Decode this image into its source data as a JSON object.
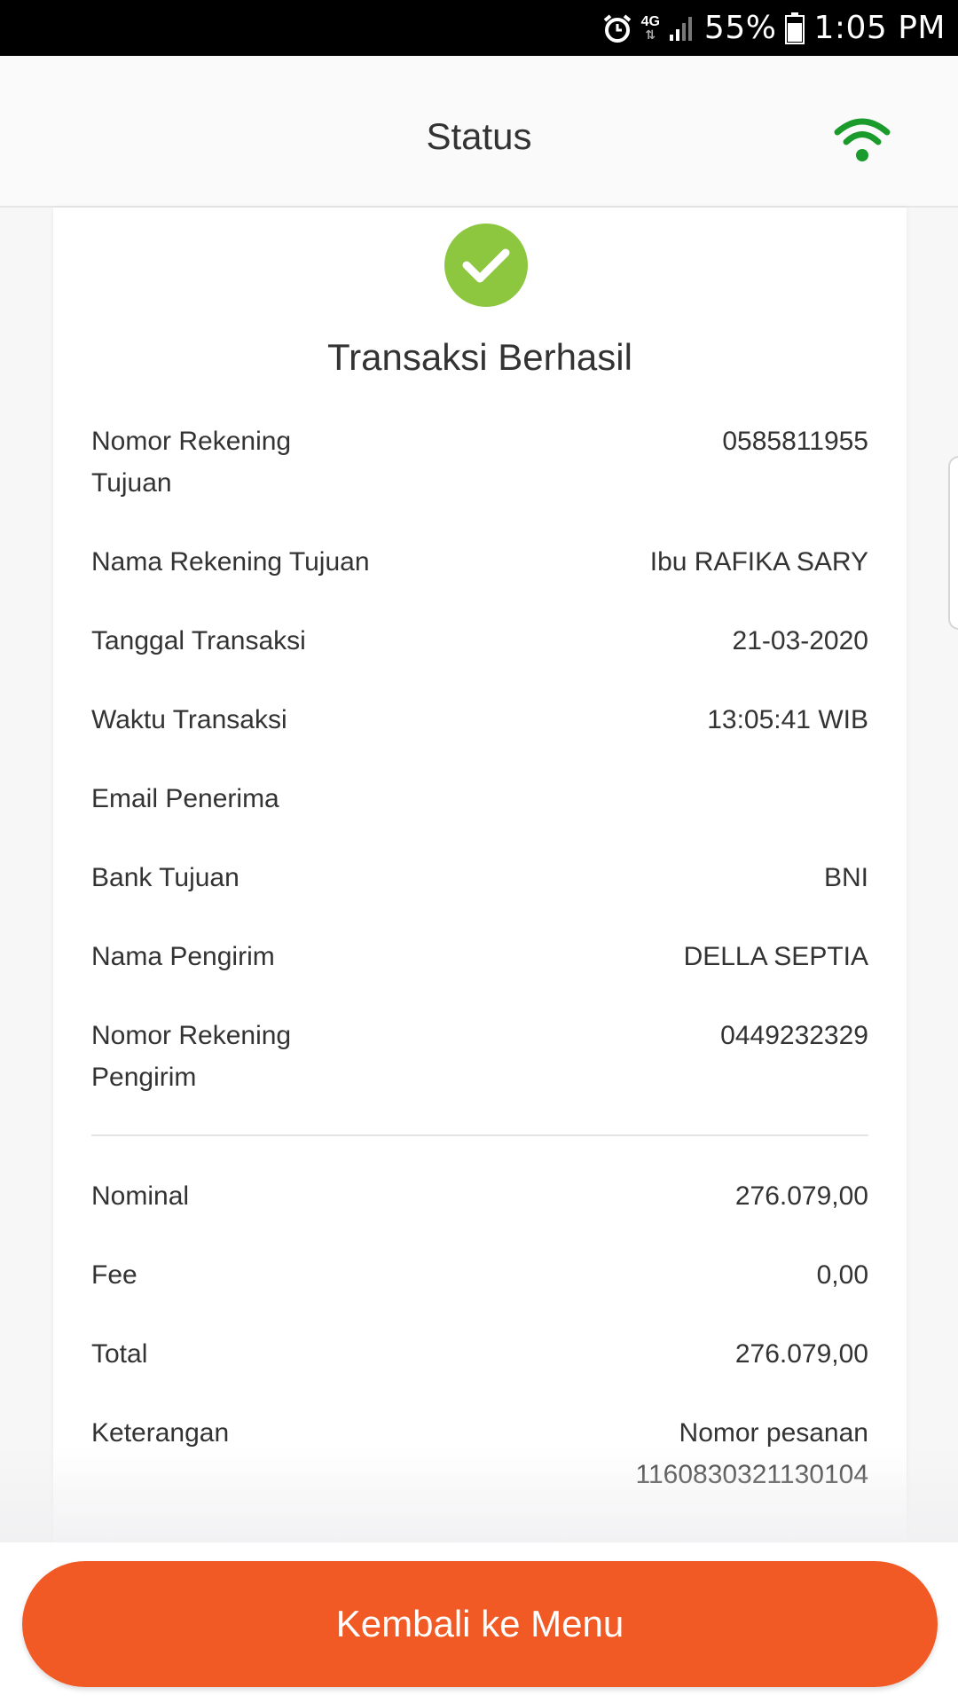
{
  "status_bar": {
    "network": "4G",
    "battery": "55%",
    "time": "1:05 PM",
    "icons": [
      "alarm-icon",
      "network-4g-icon",
      "signal-icon",
      "battery-icon"
    ]
  },
  "header": {
    "title": "Status",
    "wifi_icon": "wifi-icon",
    "wifi_color": "#1a9b2c"
  },
  "result": {
    "icon": "check-circle-icon",
    "icon_color": "#8dc63f",
    "title": "Transaksi Berhasil"
  },
  "details": [
    {
      "label": "Nomor Rekening Tujuan",
      "value": "0585811955"
    },
    {
      "label": "Nama Rekening Tujuan",
      "value": "Ibu RAFIKA SARY"
    },
    {
      "label": "Tanggal Transaksi",
      "value": "21-03-2020"
    },
    {
      "label": "Waktu Transaksi",
      "value": "13:05:41 WIB"
    },
    {
      "label": "Email Penerima",
      "value": ""
    },
    {
      "label": "Bank Tujuan",
      "value": "BNI"
    },
    {
      "label": "Nama Pengirim",
      "value": "DELLA SEPTIA"
    },
    {
      "label": "Nomor Rekening Pengirim",
      "value": "0449232329"
    }
  ],
  "amounts": [
    {
      "label": "Nominal",
      "value": "276.079,00"
    },
    {
      "label": "Fee",
      "value": "0,00"
    },
    {
      "label": "Total",
      "value": "276.079,00"
    },
    {
      "label": "Keterangan",
      "value": "Nomor pesanan 1160830321130104"
    }
  ],
  "footer": {
    "button_label": "Kembali ke Menu",
    "button_color": "#f15a24"
  }
}
